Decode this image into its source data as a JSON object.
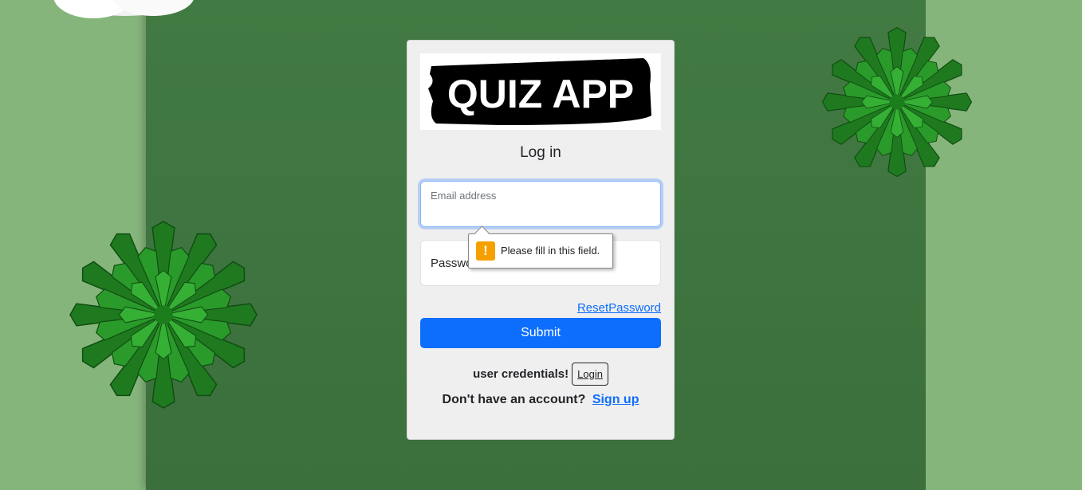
{
  "logo": {
    "text": "QUIZ APP"
  },
  "form": {
    "title": "Log in",
    "email_label": "Email address",
    "password_label": "Password",
    "reset_link": "ResetPassword",
    "submit_label": "Submit"
  },
  "validation": {
    "message": "Please fill in this field."
  },
  "credentials": {
    "text": "user credentials!",
    "login_label": "Login"
  },
  "signup": {
    "prompt": "Don't have an account?",
    "link": "Sign up"
  },
  "colors": {
    "accent": "#0d6efd",
    "background_center": "#3f7440",
    "background_side": "#86b57c",
    "card": "#f0efef"
  },
  "icons": [
    "warning-icon",
    "succulent-plant-decoration",
    "cloud-decoration"
  ]
}
